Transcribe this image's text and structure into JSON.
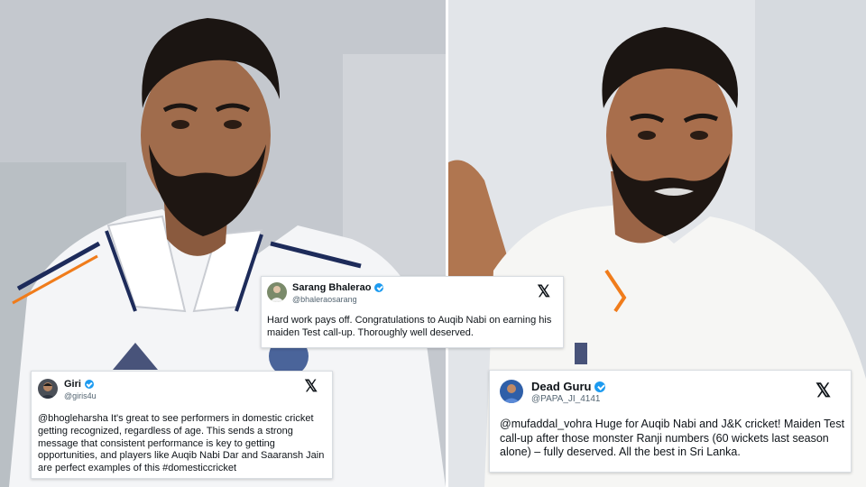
{
  "images": {
    "left_photo": "portrait photo of a bearded cricketer in a white India test jersey",
    "right_photo": "portrait photo of a bearded cricketer in a white cricket shirt"
  },
  "tweets": [
    {
      "name": "Sarang Bhalerao",
      "handle": "@bhaleraosarang",
      "text": "Hard work pays off. Congratulations to Auqib Nabi on earning his maiden Test call-up. Thoroughly well deserved.",
      "verified": true
    },
    {
      "name": "Giri",
      "handle": "@giris4u",
      "text": "@bhogleharsha It's great to see performers in domestic cricket getting recognized, regardless of age. This sends a strong message that consistent performance is key to getting opportunities, and players like Auqib Nabi Dar and Saaransh Jain are perfect examples of this #domesticcricket",
      "verified": true
    },
    {
      "name": "Dead Guru",
      "handle": "@PAPA_JI_4141",
      "text": "@mufaddal_vohra Huge for Auqib Nabi and J&K cricket! Maiden Test call-up after those monster Ranji numbers (60 wickets last season alone) – fully deserved. All the best in Sri Lanka.",
      "verified": true
    }
  ],
  "icons": {
    "x_logo": "𝕏",
    "verified": "verified-badge-icon"
  },
  "colors": {
    "verified_blue": "#1d9bf0",
    "handle_gray": "#536471",
    "text": "#0f1419"
  }
}
